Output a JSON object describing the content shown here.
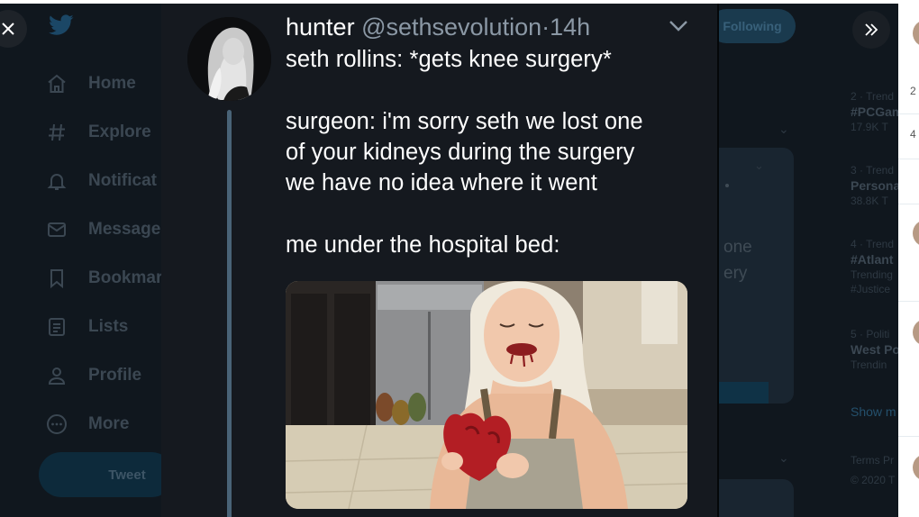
{
  "nav": {
    "items": [
      {
        "label": "Home",
        "icon": "home-icon"
      },
      {
        "label": "Explore",
        "icon": "hashtag-icon"
      },
      {
        "label": "Notificat",
        "icon": "bell-icon"
      },
      {
        "label": "Message",
        "icon": "envelope-icon"
      },
      {
        "label": "Bookmar",
        "icon": "bookmark-icon"
      },
      {
        "label": "Lists",
        "icon": "list-icon"
      },
      {
        "label": "Profile",
        "icon": "person-icon"
      },
      {
        "label": "More",
        "icon": "more-icon"
      }
    ],
    "tweet_button": "Tweet"
  },
  "background": {
    "follow_button": "Following",
    "panel_text": [
      "one",
      "ery"
    ]
  },
  "trends": [
    {
      "meta": "2 · Trend",
      "name": "#PCGam",
      "sub": "17.9K T"
    },
    {
      "meta": "3 · Trend",
      "name": "Persona",
      "sub": "38.8K T"
    },
    {
      "meta": "4 · Trend",
      "name": "#Atlant",
      "sub": "Trending",
      "sub2": "#Justice"
    },
    {
      "meta": "5 · Politi",
      "name": "West Po",
      "sub": "Trendin"
    }
  ],
  "trends_show_more": "Show m",
  "footer": {
    "terms": "Terms  Pr",
    "copyright": "© 2020 T"
  },
  "right_strip": {
    "texts": [
      "2",
      "4"
    ]
  },
  "tweet": {
    "name": "hunter",
    "handle": "@sethsevolution",
    "separator": "·",
    "time": "14h",
    "lines": [
      "seth rollins: *gets knee surgery*",
      "surgeon: i'm sorry seth we lost one",
      "of your kidneys during the surgery",
      "we have no idea where it went",
      "me under the hospital bed:"
    ]
  },
  "colors": {
    "accent": "#1da1f2",
    "card_bg": "#15191f",
    "thread_line": "#496377",
    "handle_gray": "#8b98a5"
  }
}
